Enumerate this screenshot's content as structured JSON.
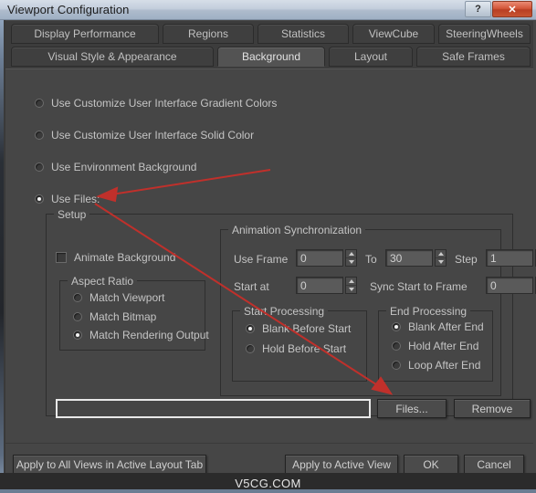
{
  "window": {
    "title": "Viewport Configuration",
    "help_button": "?",
    "close_button": "✕"
  },
  "tabs": {
    "row1": [
      {
        "label": "Display Performance",
        "active": false
      },
      {
        "label": "Regions",
        "active": false
      },
      {
        "label": "Statistics",
        "active": false
      },
      {
        "label": "ViewCube",
        "active": false
      },
      {
        "label": "SteeringWheels",
        "active": false
      }
    ],
    "row2": [
      {
        "label": "Visual Style & Appearance",
        "active": false
      },
      {
        "label": "Background",
        "active": true
      },
      {
        "label": "Layout",
        "active": false
      },
      {
        "label": "Safe Frames",
        "active": false
      }
    ]
  },
  "background_options": [
    {
      "label": "Use Customize User Interface Gradient Colors",
      "selected": false
    },
    {
      "label": "Use Customize User Interface Solid Color",
      "selected": false
    },
    {
      "label": "Use Environment Background",
      "selected": false
    },
    {
      "label": "Use Files:",
      "selected": true
    }
  ],
  "setup": {
    "title": "Setup",
    "animate_background": {
      "label": "Animate Background",
      "checked": false
    },
    "aspect_ratio": {
      "title": "Aspect Ratio",
      "options": [
        {
          "label": "Match Viewport",
          "selected": false
        },
        {
          "label": "Match Bitmap",
          "selected": false
        },
        {
          "label": "Match Rendering Output",
          "selected": true
        }
      ]
    },
    "animation_sync": {
      "title": "Animation Synchronization",
      "use_frame_label": "Use Frame",
      "use_frame_value": "0",
      "to_label": "To",
      "to_value": "30",
      "step_label": "Step",
      "step_value": "1",
      "start_at_label": "Start at",
      "start_at_value": "0",
      "sync_start_label": "Sync Start to Frame",
      "sync_start_value": "0"
    },
    "start_processing": {
      "title": "Start Processing",
      "options": [
        {
          "label": "Blank Before Start",
          "selected": true
        },
        {
          "label": "Hold Before Start",
          "selected": false
        }
      ]
    },
    "end_processing": {
      "title": "End Processing",
      "options": [
        {
          "label": "Blank After End",
          "selected": true
        },
        {
          "label": "Hold After End",
          "selected": false
        },
        {
          "label": "Loop After End",
          "selected": false
        }
      ]
    },
    "file_path": {
      "value": "",
      "placeholder": ""
    },
    "files_button": "Files...",
    "remove_button": "Remove"
  },
  "footer": {
    "apply_all_views": "Apply to All Views in Active Layout Tab",
    "apply_active_view": "Apply to Active View",
    "ok": "OK",
    "cancel": "Cancel"
  },
  "watermark": {
    "text": "V5CG.COM"
  },
  "colors": {
    "dialog_bg": "#464646",
    "tab_active": "#535353",
    "annotation_red": "#c0302b",
    "title_gradient_top": "#d6dee8",
    "close_red": "#c75432"
  }
}
